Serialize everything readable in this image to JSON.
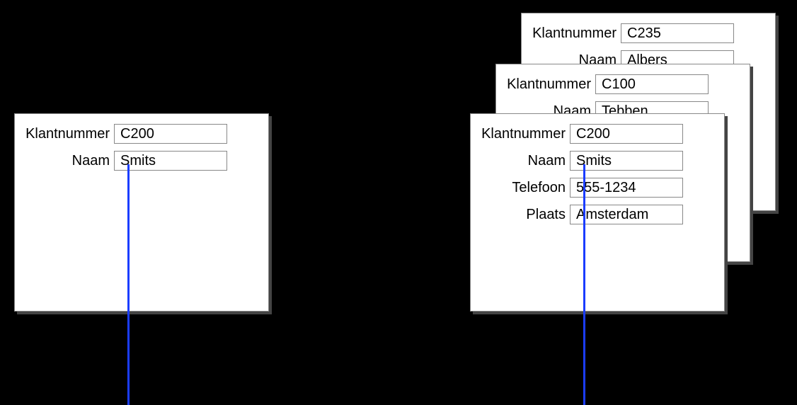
{
  "left_card": {
    "rows": [
      {
        "label": "Klantnummer",
        "value": "C200"
      },
      {
        "label": "Naam",
        "value": "Smits"
      }
    ]
  },
  "right_stack": {
    "back": {
      "rows": [
        {
          "label": "Klantnummer",
          "value": "C235"
        },
        {
          "label": "Naam",
          "value": "Albers"
        }
      ]
    },
    "middle": {
      "rows": [
        {
          "label": "Klantnummer",
          "value": "C100"
        },
        {
          "label": "Naam",
          "value": "Tebben"
        }
      ]
    },
    "front": {
      "rows": [
        {
          "label": "Klantnummer",
          "value": "C200"
        },
        {
          "label": "Naam",
          "value": "Smits"
        },
        {
          "label": "Telefoon",
          "value": "555-1234"
        },
        {
          "label": "Plaats",
          "value": "Amsterdam"
        }
      ]
    }
  }
}
